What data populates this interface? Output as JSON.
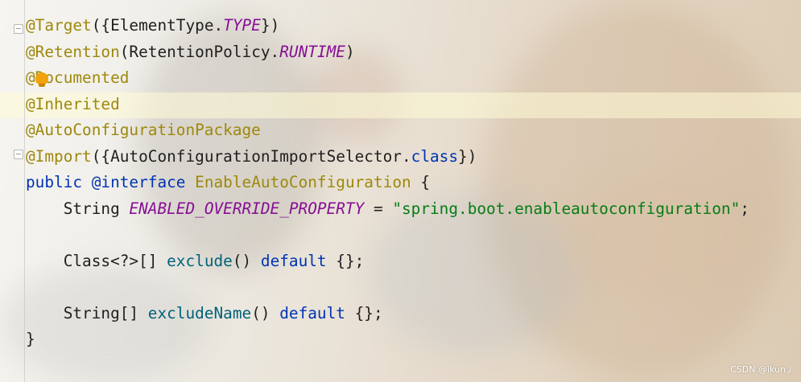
{
  "editor": {
    "lines": [
      {
        "tokens": [
          {
            "t": "@Target",
            "c": "ann"
          },
          {
            "t": "({ElementType.",
            "c": "plain"
          },
          {
            "t": "TYPE",
            "c": "const"
          },
          {
            "t": "})",
            "c": "plain"
          }
        ]
      },
      {
        "tokens": [
          {
            "t": "@Retention",
            "c": "ann"
          },
          {
            "t": "(RetentionPolicy.",
            "c": "plain"
          },
          {
            "t": "RUNTIME",
            "c": "const"
          },
          {
            "t": ")",
            "c": "plain"
          }
        ]
      },
      {
        "tokens": [
          {
            "t": "@Documented",
            "c": "ann"
          }
        ]
      },
      {
        "tokens": [
          {
            "t": "@Inherited",
            "c": "ann"
          }
        ]
      },
      {
        "tokens": [
          {
            "t": "@AutoConfigurationPackage",
            "c": "ann"
          }
        ]
      },
      {
        "tokens": [
          {
            "t": "@Import",
            "c": "ann"
          },
          {
            "t": "({AutoConfigurationImportSelector.",
            "c": "plain"
          },
          {
            "t": "class",
            "c": "kw"
          },
          {
            "t": "})",
            "c": "plain"
          }
        ]
      },
      {
        "tokens": [
          {
            "t": "public ",
            "c": "kw"
          },
          {
            "t": "@interface ",
            "c": "kw"
          },
          {
            "t": "EnableAutoConfiguration",
            "c": "cls"
          },
          {
            "t": " {",
            "c": "plain"
          }
        ]
      },
      {
        "tokens": [
          {
            "t": "    String ",
            "c": "plain"
          },
          {
            "t": "ENABLED_OVERRIDE_PROPERTY",
            "c": "const"
          },
          {
            "t": " = ",
            "c": "plain"
          },
          {
            "t": "\"spring.boot.enableautoconfiguration\"",
            "c": "str"
          },
          {
            "t": ";",
            "c": "plain"
          }
        ]
      },
      {
        "tokens": []
      },
      {
        "tokens": [
          {
            "t": "    Class<?>[] ",
            "c": "plain"
          },
          {
            "t": "exclude",
            "c": "meth"
          },
          {
            "t": "() ",
            "c": "plain"
          },
          {
            "t": "default",
            "c": "kw"
          },
          {
            "t": " {};",
            "c": "plain"
          }
        ]
      },
      {
        "tokens": []
      },
      {
        "tokens": [
          {
            "t": "    String[] ",
            "c": "plain"
          },
          {
            "t": "excludeName",
            "c": "meth"
          },
          {
            "t": "() ",
            "c": "plain"
          },
          {
            "t": "default",
            "c": "kw"
          },
          {
            "t": " {};",
            "c": "plain"
          }
        ]
      },
      {
        "tokens": [
          {
            "t": "}",
            "c": "plain"
          }
        ]
      }
    ]
  },
  "icons": {
    "intention_bulb": "lightbulb-icon",
    "fold_top": "fold-marker-icon",
    "fold_bottom": "fold-marker-icon"
  },
  "watermark": "CSDN @ikun丿"
}
